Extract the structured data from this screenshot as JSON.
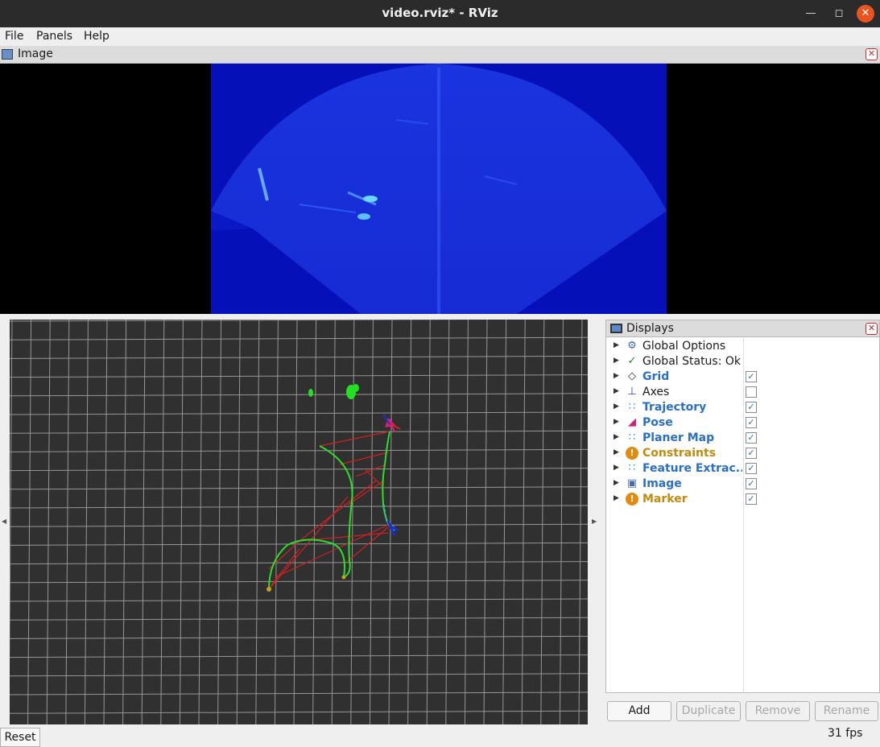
{
  "window": {
    "title": "video.rviz* - RViz"
  },
  "menu": {
    "file": "File",
    "panels": "Panels",
    "help": "Help"
  },
  "image_panel": {
    "title": "Image"
  },
  "displays_panel": {
    "title": "Displays",
    "items": [
      {
        "label": "Global Options",
        "icon": "gear-icon",
        "checkbox": null,
        "style": "plain"
      },
      {
        "label": "Global Status: Ok",
        "icon": "check-icon",
        "checkbox": null,
        "style": "plain"
      },
      {
        "label": "Grid",
        "icon": "grid-icon",
        "checkbox": true,
        "style": "blue"
      },
      {
        "label": "Axes",
        "icon": "axes-icon",
        "checkbox": false,
        "style": "plain"
      },
      {
        "label": "Trajectory",
        "icon": "points-icon",
        "checkbox": true,
        "style": "blue"
      },
      {
        "label": "Pose",
        "icon": "pose-arrow-icon",
        "checkbox": true,
        "style": "blue"
      },
      {
        "label": "Planer Map",
        "icon": "points-icon",
        "checkbox": true,
        "style": "blue"
      },
      {
        "label": "Constraints",
        "icon": "warning-icon",
        "checkbox": true,
        "style": "gold"
      },
      {
        "label": "Feature Extrac...",
        "icon": "points-icon",
        "checkbox": true,
        "style": "blue"
      },
      {
        "label": "Image",
        "icon": "image-icon",
        "checkbox": true,
        "style": "blue"
      },
      {
        "label": "Marker",
        "icon": "warning-icon",
        "checkbox": true,
        "style": "gold"
      }
    ]
  },
  "buttons": {
    "add": "Add",
    "duplicate": "Duplicate",
    "remove": "Remove",
    "rename": "Rename"
  },
  "status": {
    "reset": "Reset",
    "fps": "31 fps"
  },
  "colors": {
    "sonar_bg": "#0610b8",
    "grid": "#a8a8a8",
    "viewport_bg": "#303030",
    "trajectory": "#2adf2a",
    "constraints": "#d42020",
    "accent_blue": "#2a6fc2",
    "accent_gold": "#c48a10"
  }
}
